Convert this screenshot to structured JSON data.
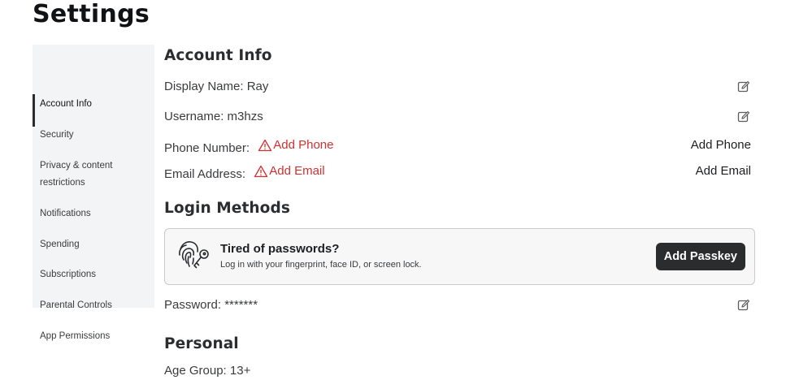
{
  "page": {
    "title": "Settings"
  },
  "sidebar": {
    "items": [
      {
        "label": "Account Info",
        "active": true
      },
      {
        "label": "Security"
      },
      {
        "label": "Privacy & content",
        "label2": "restrictions"
      },
      {
        "label": "Notifications"
      },
      {
        "label": "Spending"
      },
      {
        "label": "Subscriptions"
      },
      {
        "label": "Parental Controls"
      },
      {
        "label": "App Permissions"
      }
    ]
  },
  "account_info": {
    "title": "Account Info",
    "display_name": "Display Name: Ray",
    "username": "Username: m3hzs",
    "phone_label": "Phone Number:",
    "phone_warning": "Add Phone",
    "phone_action": "Add Phone",
    "email_label": "Email Address:",
    "email_warning": "Add Email",
    "email_action": "Add Email"
  },
  "login_methods": {
    "title": "Login Methods",
    "passkey_title": "Tired of passwords?",
    "passkey_subtitle": "Log in with your fingerprint, face ID, or screen lock.",
    "passkey_button": "Add Passkey",
    "password": "Password: *******"
  },
  "personal": {
    "title": "Personal",
    "age_group": "Age Group: 13+"
  },
  "colors": {
    "warning": "#d32f2f",
    "button_bg": "#2a2c2e",
    "sidebar_bg": "#f2f4f5"
  },
  "icons": [
    "edit-icon",
    "warning-icon",
    "fingerprint-key-icon"
  ]
}
